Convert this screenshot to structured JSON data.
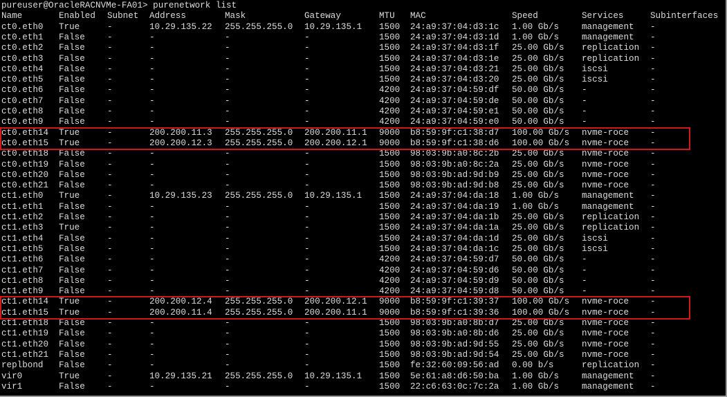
{
  "prompt": "pureuser@OracleRACNVMe-FA01> purenetwork list",
  "columns": [
    "Name",
    "Enabled",
    "Subnet",
    "Address",
    "Mask",
    "Gateway",
    "MTU",
    "MAC",
    "Speed",
    "Services",
    "Subinterfaces"
  ],
  "highlight_color": "#d01818",
  "rows": [
    {
      "cells": [
        "ct0.eth0",
        "True",
        "-",
        "10.29.135.22",
        "255.255.255.0",
        "10.29.135.1",
        "1500",
        "24:a9:37:04:d3:1c",
        "1.00 Gb/s",
        "management",
        "-"
      ]
    },
    {
      "cells": [
        "ct0.eth1",
        "False",
        "-",
        "-",
        "-",
        "-",
        "1500",
        "24:a9:37:04:d3:1d",
        "1.00 Gb/s",
        "management",
        "-"
      ]
    },
    {
      "cells": [
        "ct0.eth2",
        "False",
        "-",
        "-",
        "-",
        "-",
        "1500",
        "24:a9:37:04:d3:1f",
        "25.00 Gb/s",
        "replication",
        "-"
      ]
    },
    {
      "cells": [
        "ct0.eth3",
        "False",
        "-",
        "-",
        "-",
        "-",
        "1500",
        "24:a9:37:04:d3:1e",
        "25.00 Gb/s",
        "replication",
        "-"
      ]
    },
    {
      "cells": [
        "ct0.eth4",
        "False",
        "-",
        "-",
        "-",
        "-",
        "1500",
        "24:a9:37:04:d3:21",
        "25.00 Gb/s",
        "iscsi",
        "-"
      ]
    },
    {
      "cells": [
        "ct0.eth5",
        "False",
        "-",
        "-",
        "-",
        "-",
        "1500",
        "24:a9:37:04:d3:20",
        "25.00 Gb/s",
        "iscsi",
        "-"
      ]
    },
    {
      "cells": [
        "ct0.eth6",
        "False",
        "-",
        "-",
        "-",
        "-",
        "4200",
        "24:a9:37:04:59:df",
        "50.00 Gb/s",
        "-",
        "-"
      ]
    },
    {
      "cells": [
        "ct0.eth7",
        "False",
        "-",
        "-",
        "-",
        "-",
        "4200",
        "24:a9:37:04:59:de",
        "50.00 Gb/s",
        "-",
        "-"
      ]
    },
    {
      "cells": [
        "ct0.eth8",
        "False",
        "-",
        "-",
        "-",
        "-",
        "4200",
        "24:a9:37:04:59:e1",
        "50.00 Gb/s",
        "-",
        "-"
      ]
    },
    {
      "cells": [
        "ct0.eth9",
        "False",
        "-",
        "-",
        "-",
        "-",
        "4200",
        "24:a9:37:04:59:e0",
        "50.00 Gb/s",
        "-",
        "-"
      ]
    },
    {
      "cells": [
        "ct0.eth14",
        "True",
        "-",
        "200.200.11.3",
        "255.255.255.0",
        "200.200.11.1",
        "9000",
        "b8:59:9f:c1:38:d7",
        "100.00 Gb/s",
        "nvme-roce",
        "-"
      ],
      "highlight": true
    },
    {
      "cells": [
        "ct0.eth15",
        "True",
        "-",
        "200.200.12.3",
        "255.255.255.0",
        "200.200.12.1",
        "9000",
        "b8:59:9f:c1:38:d6",
        "100.00 Gb/s",
        "nvme-roce",
        "-"
      ],
      "highlight": true
    },
    {
      "cells": [
        "ct0.eth18",
        "False",
        "-",
        "-",
        "-",
        "-",
        "1500",
        "98:03:9b:a0:8c:2b",
        "25.00 Gb/s",
        "nvme-roce",
        "-"
      ]
    },
    {
      "cells": [
        "ct0.eth19",
        "False",
        "-",
        "-",
        "-",
        "-",
        "1500",
        "98:03:9b:a0:8c:2a",
        "25.00 Gb/s",
        "nvme-roce",
        "-"
      ]
    },
    {
      "cells": [
        "ct0.eth20",
        "False",
        "-",
        "-",
        "-",
        "-",
        "1500",
        "98:03:9b:ad:9d:b9",
        "25.00 Gb/s",
        "nvme-roce",
        "-"
      ]
    },
    {
      "cells": [
        "ct0.eth21",
        "False",
        "-",
        "-",
        "-",
        "-",
        "1500",
        "98:03:9b:ad:9d:b8",
        "25.00 Gb/s",
        "nvme-roce",
        "-"
      ]
    },
    {
      "cells": [
        "ct1.eth0",
        "True",
        "-",
        "10.29.135.23",
        "255.255.255.0",
        "10.29.135.1",
        "1500",
        "24:a9:37:04:da:18",
        "1.00 Gb/s",
        "management",
        "-"
      ]
    },
    {
      "cells": [
        "ct1.eth1",
        "False",
        "-",
        "-",
        "-",
        "-",
        "1500",
        "24:a9:37:04:da:19",
        "1.00 Gb/s",
        "management",
        "-"
      ]
    },
    {
      "cells": [
        "ct1.eth2",
        "False",
        "-",
        "-",
        "-",
        "-",
        "1500",
        "24:a9:37:04:da:1b",
        "25.00 Gb/s",
        "replication",
        "-"
      ]
    },
    {
      "cells": [
        "ct1.eth3",
        "True",
        "-",
        "-",
        "-",
        "-",
        "1500",
        "24:a9:37:04:da:1a",
        "25.00 Gb/s",
        "replication",
        "-"
      ]
    },
    {
      "cells": [
        "ct1.eth4",
        "False",
        "-",
        "-",
        "-",
        "-",
        "1500",
        "24:a9:37:04:da:1d",
        "25.00 Gb/s",
        "iscsi",
        "-"
      ]
    },
    {
      "cells": [
        "ct1.eth5",
        "False",
        "-",
        "-",
        "-",
        "-",
        "1500",
        "24:a9:37:04:da:1c",
        "25.00 Gb/s",
        "iscsi",
        "-"
      ]
    },
    {
      "cells": [
        "ct1.eth6",
        "False",
        "-",
        "-",
        "-",
        "-",
        "4200",
        "24:a9:37:04:59:d7",
        "50.00 Gb/s",
        "-",
        "-"
      ]
    },
    {
      "cells": [
        "ct1.eth7",
        "False",
        "-",
        "-",
        "-",
        "-",
        "4200",
        "24:a9:37:04:59:d6",
        "50.00 Gb/s",
        "-",
        "-"
      ]
    },
    {
      "cells": [
        "ct1.eth8",
        "False",
        "-",
        "-",
        "-",
        "-",
        "4200",
        "24:a9:37:04:59:d9",
        "50.00 Gb/s",
        "-",
        "-"
      ]
    },
    {
      "cells": [
        "ct1.eth9",
        "False",
        "-",
        "-",
        "-",
        "-",
        "4200",
        "24:a9:37:04:59:d8",
        "50.00 Gb/s",
        "-",
        "-"
      ]
    },
    {
      "cells": [
        "ct1.eth14",
        "True",
        "-",
        "200.200.12.4",
        "255.255.255.0",
        "200.200.12.1",
        "9000",
        "b8:59:9f:c1:39:37",
        "100.00 Gb/s",
        "nvme-roce",
        "-"
      ],
      "highlight": true
    },
    {
      "cells": [
        "ct1.eth15",
        "True",
        "-",
        "200.200.11.4",
        "255.255.255.0",
        "200.200.11.1",
        "9000",
        "b8:59:9f:c1:39:36",
        "100.00 Gb/s",
        "nvme-roce",
        "-"
      ],
      "highlight": true
    },
    {
      "cells": [
        "ct1.eth18",
        "False",
        "-",
        "-",
        "-",
        "-",
        "1500",
        "98:03:9b:a0:8b:d7",
        "25.00 Gb/s",
        "nvme-roce",
        "-"
      ]
    },
    {
      "cells": [
        "ct1.eth19",
        "False",
        "-",
        "-",
        "-",
        "-",
        "1500",
        "98:03:9b:a0:8b:d6",
        "25.00 Gb/s",
        "nvme-roce",
        "-"
      ]
    },
    {
      "cells": [
        "ct1.eth20",
        "False",
        "-",
        "-",
        "-",
        "-",
        "1500",
        "98:03:9b:ad:9d:55",
        "25.00 Gb/s",
        "nvme-roce",
        "-"
      ]
    },
    {
      "cells": [
        "ct1.eth21",
        "False",
        "-",
        "-",
        "-",
        "-",
        "1500",
        "98:03:9b:ad:9d:54",
        "25.00 Gb/s",
        "nvme-roce",
        "-"
      ]
    },
    {
      "cells": [
        "replbond",
        "False",
        "-",
        "-",
        "-",
        "-",
        "1500",
        "fe:32:60:09:56:ad",
        "0.00 b/s",
        "replication",
        "-"
      ]
    },
    {
      "cells": [
        "vir0",
        "True",
        "-",
        "10.29.135.21",
        "255.255.255.0",
        "10.29.135.1",
        "1500",
        "5e:61:a8:d6:50:ba",
        "1.00 Gb/s",
        "management",
        "-"
      ]
    },
    {
      "cells": [
        "vir1",
        "False",
        "-",
        "-",
        "-",
        "-",
        "1500",
        "22:c6:63:0c:7c:2a",
        "1.00 Gb/s",
        "management",
        "-"
      ]
    }
  ]
}
